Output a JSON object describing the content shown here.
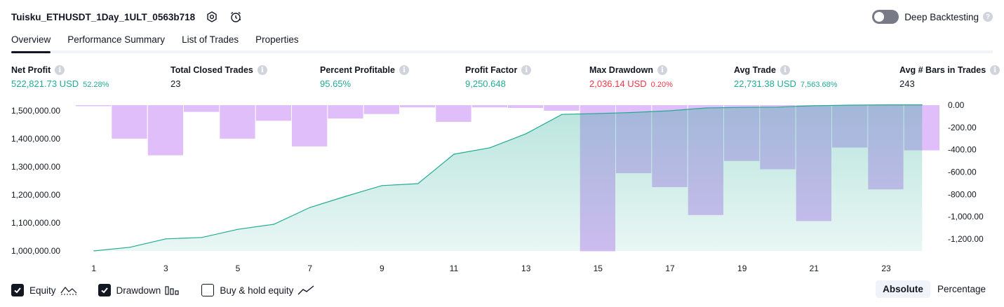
{
  "header": {
    "strategy_title": "Tuisku_ETHUSDT_1Day_1ULT_0563b718",
    "deep_backtesting_label": "Deep Backtesting",
    "deep_backtesting_enabled": false
  },
  "tabs": [
    {
      "label": "Overview",
      "active": true
    },
    {
      "label": "Performance Summary",
      "active": false
    },
    {
      "label": "List of Trades",
      "active": false
    },
    {
      "label": "Properties",
      "active": false
    }
  ],
  "metrics": [
    {
      "label": "Net Profit",
      "value": "522,821.73 USD",
      "sub": "52.28%",
      "color": "green"
    },
    {
      "label": "Total Closed Trades",
      "value": "23",
      "sub": "",
      "color": "dark"
    },
    {
      "label": "Percent Profitable",
      "value": "95.65%",
      "sub": "",
      "color": "green"
    },
    {
      "label": "Profit Factor",
      "value": "9,250.648",
      "sub": "",
      "color": "green"
    },
    {
      "label": "Max Drawdown",
      "value": "2,036.14 USD",
      "sub": "0.20%",
      "color": "red"
    },
    {
      "label": "Avg Trade",
      "value": "22,731.38 USD",
      "sub": "7,563.68%",
      "color": "green"
    },
    {
      "label": "Avg # Bars in Trades",
      "value": "243",
      "sub": "",
      "color": "dark"
    }
  ],
  "chart_data": {
    "type": "line",
    "x_ticks": [
      "1",
      "3",
      "5",
      "7",
      "9",
      "11",
      "13",
      "15",
      "17",
      "19",
      "21",
      "23"
    ],
    "x": [
      1,
      2,
      3,
      4,
      5,
      6,
      7,
      8,
      9,
      10,
      11,
      12,
      13,
      14,
      15,
      16,
      17,
      18,
      19,
      20,
      21,
      22,
      23,
      24
    ],
    "left_axis": {
      "ticks": [
        "1,500,000.00",
        "1,400,000.00",
        "1,300,000.00",
        "1,200,000.00",
        "1,100,000.00",
        "1,000,000.00"
      ],
      "ylim": [
        1000000,
        1500000
      ]
    },
    "right_axis": {
      "ticks": [
        "0.00",
        "-200.00",
        "-400.00",
        "-600.00",
        "-800.00",
        "-1,000.00",
        "-1,200.00"
      ],
      "ylim": [
        -1300,
        0
      ]
    },
    "series": [
      {
        "name": "Equity",
        "axis": "left",
        "values": [
          1000000,
          1013000,
          1043000,
          1048000,
          1077000,
          1095000,
          1155000,
          1195000,
          1233000,
          1240000,
          1345000,
          1368000,
          1418000,
          1487000,
          1490000,
          1494000,
          1500000,
          1510000,
          1512000,
          1513000,
          1518000,
          1520000,
          1521000,
          1521000
        ],
        "color": "#22ab94"
      },
      {
        "name": "Drawdown",
        "axis": "right",
        "values": [
          -5,
          -300,
          -450,
          -60,
          -300,
          -140,
          -370,
          -120,
          -80,
          -20,
          -150,
          -20,
          -25,
          -50,
          -1310,
          -610,
          -735,
          -985,
          -500,
          -575,
          -1040,
          -380,
          -755,
          -405
        ],
        "color": "#d1a3f7"
      }
    ]
  },
  "legend": [
    {
      "label": "Equity",
      "checked": true,
      "icon": "equity-line-icon"
    },
    {
      "label": "Drawdown",
      "checked": true,
      "icon": "drawdown-bars-icon"
    },
    {
      "label": "Buy & hold equity",
      "checked": false,
      "icon": "buy-hold-line-icon"
    }
  ],
  "mode": {
    "absolute_label": "Absolute",
    "percentage_label": "Percentage",
    "active": "absolute"
  },
  "colors": {
    "accent_green": "#22ab94",
    "accent_red": "#f23645",
    "drawdown_purple": "#d1a3f7"
  }
}
